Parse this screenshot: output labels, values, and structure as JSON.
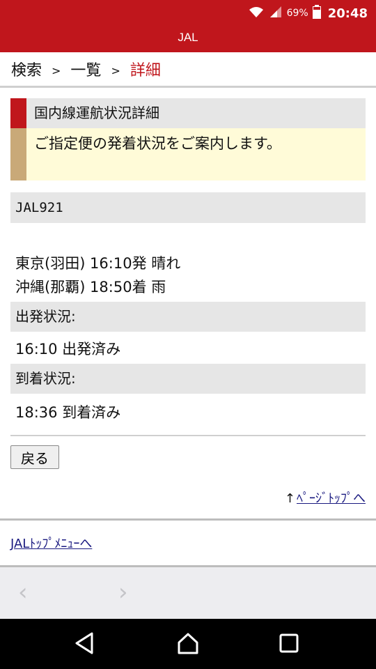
{
  "status_bar": {
    "battery_percent": "69%",
    "time": "20:48"
  },
  "header": {
    "title": "JAL"
  },
  "breadcrumb": {
    "items": [
      "検索",
      "一覧",
      "詳細"
    ],
    "separator": ">"
  },
  "section": {
    "title": "国内線運航状況詳細",
    "message": "ご指定便の発着状況をご案内します。"
  },
  "flight": {
    "number": "JAL921",
    "departure_line": "東京(羽田) 16:10発 晴れ",
    "arrival_line": "沖縄(那覇) 18:50着 雨",
    "departure_status_label": "出発状況:",
    "departure_status": "16:10 出発済み",
    "arrival_status_label": "到着状況:",
    "arrival_status": "18:36 到着済み"
  },
  "buttons": {
    "back": "戻る"
  },
  "links": {
    "page_top_arrow": "↑",
    "page_top": "ﾍﾟｰｼﾞﾄｯﾌﾟへ",
    "jal_top_menu": "JALﾄｯﾌﾟﾒﾆｭｰへ"
  },
  "browser_nav": {
    "back_glyph": "‹",
    "forward_glyph": "›"
  },
  "colors": {
    "brand_red": "#c0161c",
    "accent_tan": "#c9a978",
    "notice_bg": "#fffbd8",
    "link": "#1a1a80"
  }
}
